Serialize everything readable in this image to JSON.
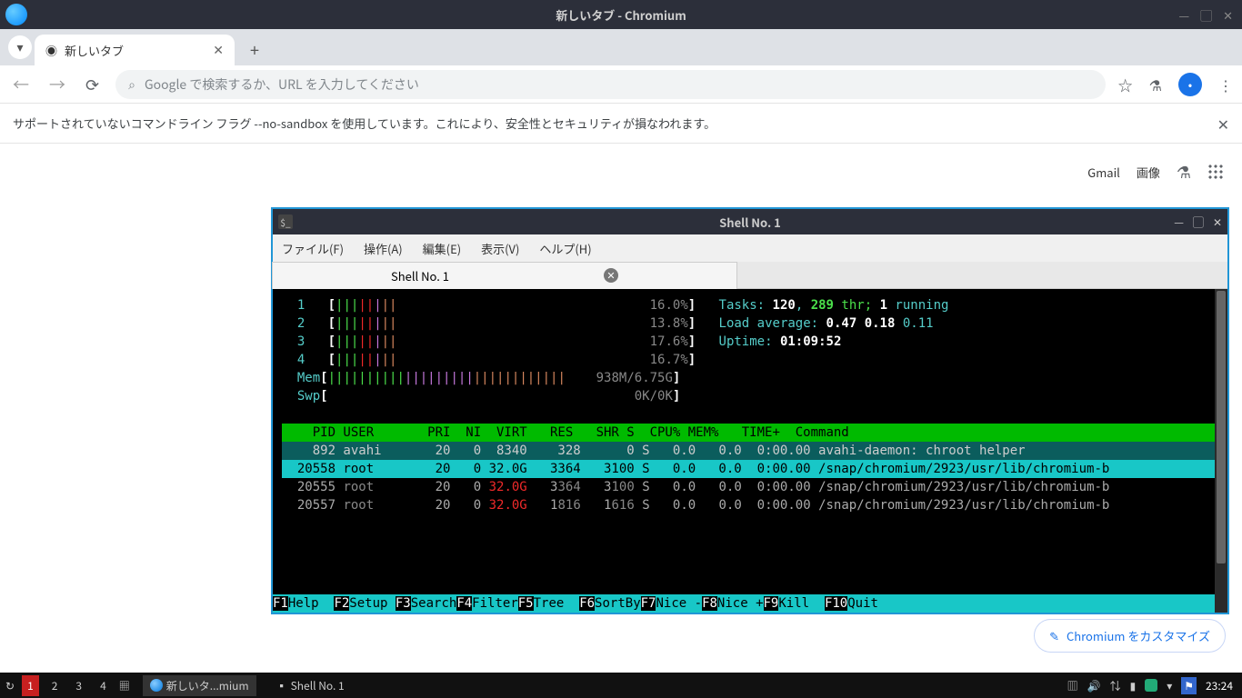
{
  "window": {
    "title": "新しいタブ - Chromium"
  },
  "tab": {
    "label": "新しいタブ"
  },
  "omnibox": {
    "placeholder": "Google で検索するか、URL を入力してください"
  },
  "warning": {
    "text": "サポートされていないコマンドライン フラグ --no-sandbox を使用しています。これにより、安全性とセキュリティが損なわれます。"
  },
  "links": {
    "gmail": "Gmail",
    "images": "画像"
  },
  "customize": {
    "label": "Chromium をカスタマイズ"
  },
  "terminal": {
    "title": "Shell No. 1",
    "menus": {
      "file": "ファイル(F)",
      "operation": "操作(A)",
      "edit": "編集(E)",
      "view": "表示(V)",
      "help": "ヘルプ(H)"
    },
    "tab": "Shell No. 1"
  },
  "htop": {
    "cpu": [
      {
        "id": "1",
        "pct": "16.0%"
      },
      {
        "id": "2",
        "pct": "13.8%"
      },
      {
        "id": "3",
        "pct": "17.6%"
      },
      {
        "id": "4",
        "pct": "16.7%"
      }
    ],
    "mem_label": "Mem",
    "mem_val": "938M/6.75G",
    "swp_label": "Swp",
    "swp_val": "0K/0K",
    "tasks_label": "Tasks: ",
    "tasks_procs": "120",
    "tasks_sep1": ", ",
    "tasks_thr": "289",
    "tasks_thrlbl": " thr; ",
    "tasks_run": "1",
    "tasks_runlbl": " running",
    "load_label": "Load average: ",
    "load1": "0.47",
    "load2": "0.18",
    "load3": "0.11",
    "uptime_label": "Uptime: ",
    "uptime": "01:09:52",
    "header": "    PID USER       PRI  NI  VIRT   RES   SHR S  CPU% MEM%   TIME+  Command",
    "rows": [
      {
        "pid": "892",
        "user": "avahi",
        "pri": "20",
        "ni": "0",
        "virt": "8340",
        "res": "328",
        "shr": "0",
        "s": "S",
        "cpu": "0.0",
        "mem": "0.0",
        "time": "0:00.00",
        "cmd": "avahi-daemon: chroot helper"
      },
      {
        "pid": "20558",
        "user": "root",
        "pri": "20",
        "ni": "0",
        "virt": "32.0G",
        "res": "3364",
        "shr": "3100",
        "s": "S",
        "cpu": "0.0",
        "mem": "0.0",
        "time": "0:00.00",
        "cmd": "/snap/chromium/2923/usr/lib/chromium-b"
      },
      {
        "pid": "20555",
        "user": "root",
        "pri": "20",
        "ni": "0",
        "virt": "32.0G",
        "res": "3364",
        "shr": "3100",
        "s": "S",
        "cpu": "0.0",
        "mem": "0.0",
        "time": "0:00.00",
        "cmd": "/snap/chromium/2923/usr/lib/chromium-b"
      },
      {
        "pid": "20557",
        "user": "root",
        "pri": "20",
        "ni": "0",
        "virt": "32.0G",
        "res": "1816",
        "shr": "1616",
        "s": "S",
        "cpu": "0.0",
        "mem": "0.0",
        "time": "0:00.00",
        "cmd": "/snap/chromium/2923/usr/lib/chromium-b"
      }
    ],
    "fkeys": [
      {
        "k": "F1",
        "l": "Help  "
      },
      {
        "k": "F2",
        "l": "Setup "
      },
      {
        "k": "F3",
        "l": "Search"
      },
      {
        "k": "F4",
        "l": "Filter"
      },
      {
        "k": "F5",
        "l": "Tree  "
      },
      {
        "k": "F6",
        "l": "SortBy"
      },
      {
        "k": "F7",
        "l": "Nice -"
      },
      {
        "k": "F8",
        "l": "Nice +"
      },
      {
        "k": "F9",
        "l": "Kill  "
      },
      {
        "k": "F10",
        "l": "Quit  "
      }
    ]
  },
  "taskbar": {
    "workspaces": [
      "1",
      "2",
      "3",
      "4"
    ],
    "tasks": [
      {
        "label": "新しいタ...mium"
      },
      {
        "label": "Shell No. 1"
      }
    ],
    "clock": "23:24"
  }
}
